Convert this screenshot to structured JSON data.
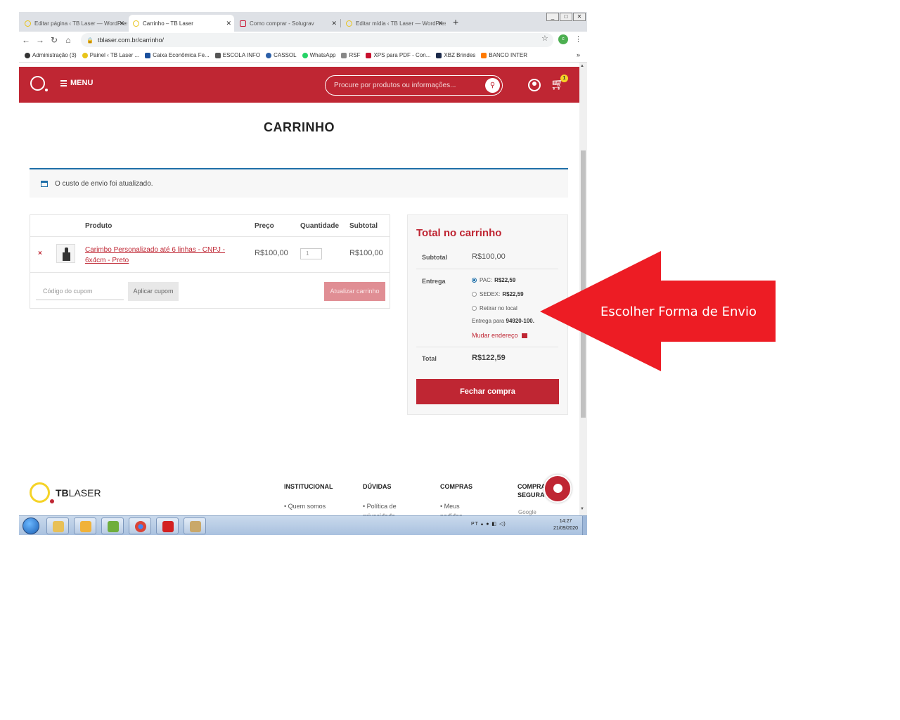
{
  "browser": {
    "tabs": [
      {
        "label": "Editar página ‹ TB Laser — WordPress",
        "active": false
      },
      {
        "label": "Carrinho – TB Laser",
        "active": true
      },
      {
        "label": "Como comprar - Solugrav",
        "active": false
      },
      {
        "label": "Editar mídia ‹ TB Laser — WordPress",
        "active": false
      }
    ],
    "new_tab": "+",
    "url": "tblaser.com.br/carrinho/",
    "profile_initial": "c",
    "bookmarks": [
      "Administração (3)",
      "Painel ‹ TB Laser ...",
      "Caixa Econômica Fe...",
      "ESCOLA INFO",
      "CASSOL",
      "WhatsApp",
      "RSF",
      "XPS para PDF - Con...",
      "XBZ Brindes",
      "BANCO INTER"
    ],
    "bookmarks_more": "»"
  },
  "site": {
    "menu_label": "MENU",
    "search_placeholder": "Procure por produtos ou informações...",
    "cart_count": "1",
    "page_title": "CARRINHO",
    "notice": "O custo de envio foi atualizado.",
    "table": {
      "headers": {
        "product": "Produto",
        "price": "Preço",
        "quantity": "Quantidade",
        "subtotal": "Subtotal"
      },
      "row": {
        "remove": "×",
        "product_name": "Carimbo Personalizado até 6 linhas - CNPJ - 6x4cm - Preto",
        "price": "R$100,00",
        "quantity": "1",
        "subtotal": "R$100,00"
      },
      "coupon_placeholder": "Código do cupom",
      "apply_coupon": "Aplicar cupom",
      "update_cart": "Atualizar carrinho"
    },
    "totals": {
      "title": "Total no carrinho",
      "subtotal_label": "Subtotal",
      "subtotal_value": "R$100,00",
      "shipping_label": "Entrega",
      "shipping_options": [
        {
          "name": "PAC:",
          "price": "R$22,59",
          "selected": true
        },
        {
          "name": "SEDEX:",
          "price": "R$22,59",
          "selected": false
        },
        {
          "name": "Retirar no local",
          "price": "",
          "selected": false
        }
      ],
      "deliver_to_prefix": "Entrega para",
      "deliver_to_zip": "94920-100.",
      "change_address": "Mudar endereço",
      "total_label": "Total",
      "total_value": "R$122,59",
      "checkout": "Fechar compra"
    },
    "footer": {
      "logo_bold": "TB",
      "logo_light": "LASER",
      "columns": [
        {
          "title": "INSTITUCIONAL",
          "link": "• Quem somos"
        },
        {
          "title": "DÚVIDAS",
          "link": "• Política de privacidade"
        },
        {
          "title": "COMPRAS",
          "link": "• Meus pedidos"
        },
        {
          "title": "COMPRA SEGURA",
          "link": ""
        }
      ],
      "google_badge": "Google"
    }
  },
  "taskbar": {
    "tray": "PT",
    "time": "14:27",
    "date": "21/09/2020"
  },
  "annotation": {
    "text": "Escolher Forma de Envio",
    "color": "#ed1c24"
  }
}
